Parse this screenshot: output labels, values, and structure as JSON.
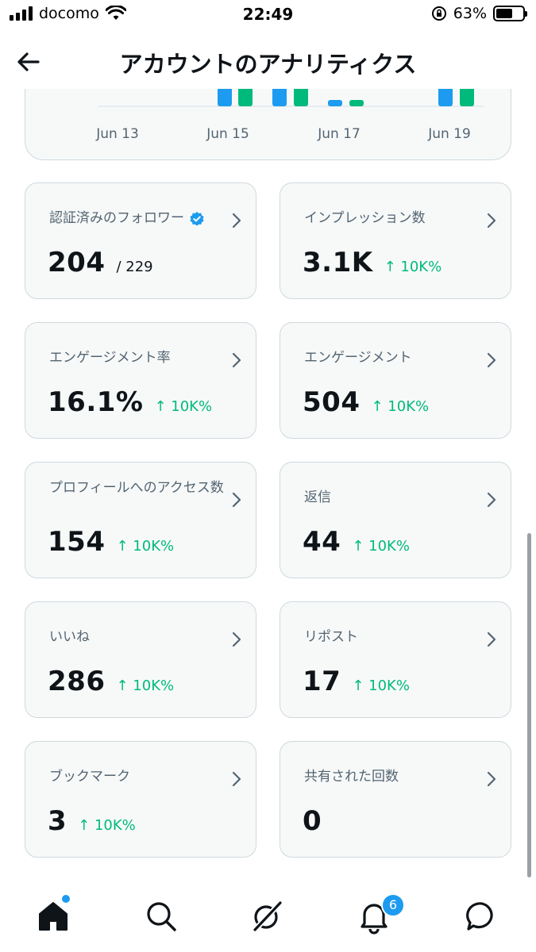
{
  "status_bar": {
    "carrier": "docomo",
    "time": "22:49",
    "battery_percent": "63%",
    "battery_level": 0.63,
    "icons": [
      "signal-icon",
      "wifi-icon",
      "orientation-lock-icon",
      "battery-icon"
    ]
  },
  "header": {
    "title": "アカウントのアナリティクス",
    "back_icon": "arrow-left-icon"
  },
  "chart": {
    "x_labels": [
      "Jun 13",
      "Jun 15",
      "Jun 17",
      "Jun 19"
    ],
    "colors": {
      "blue": "#1d9bf0",
      "green": "#00ba7c"
    }
  },
  "stats": [
    {
      "label": "認証済みのフォロワー",
      "value": "204",
      "sub": "/ 229",
      "delta": "",
      "verified": true
    },
    {
      "label": "インプレッション数",
      "value": "3.1K",
      "sub": "",
      "delta": "↑ 10K%"
    },
    {
      "label": "エンゲージメント率",
      "value": "16.1%",
      "sub": "",
      "delta": "↑ 10K%"
    },
    {
      "label": "エンゲージメント",
      "value": "504",
      "sub": "",
      "delta": "↑ 10K%"
    },
    {
      "label": "プロフィールへのアクセス数",
      "value": "154",
      "sub": "",
      "delta": "↑ 10K%"
    },
    {
      "label": "返信",
      "value": "44",
      "sub": "",
      "delta": "↑ 10K%"
    },
    {
      "label": "いいね",
      "value": "286",
      "sub": "",
      "delta": "↑ 10K%"
    },
    {
      "label": "リポスト",
      "value": "17",
      "sub": "",
      "delta": "↑ 10K%"
    },
    {
      "label": "ブックマーク",
      "value": "3",
      "sub": "",
      "delta": "↑ 10K%"
    },
    {
      "label": "共有された回数",
      "value": "0",
      "sub": "",
      "delta": ""
    }
  ],
  "bottom_nav": {
    "items": [
      "home-icon",
      "search-icon",
      "grok-icon",
      "notifications-icon",
      "messages-icon"
    ],
    "notification_count": "6"
  },
  "colors": {
    "accent": "#1d9bf0",
    "positive": "#00ba7c",
    "card_bg": "#f7f9f9",
    "border": "#cfd9de"
  }
}
